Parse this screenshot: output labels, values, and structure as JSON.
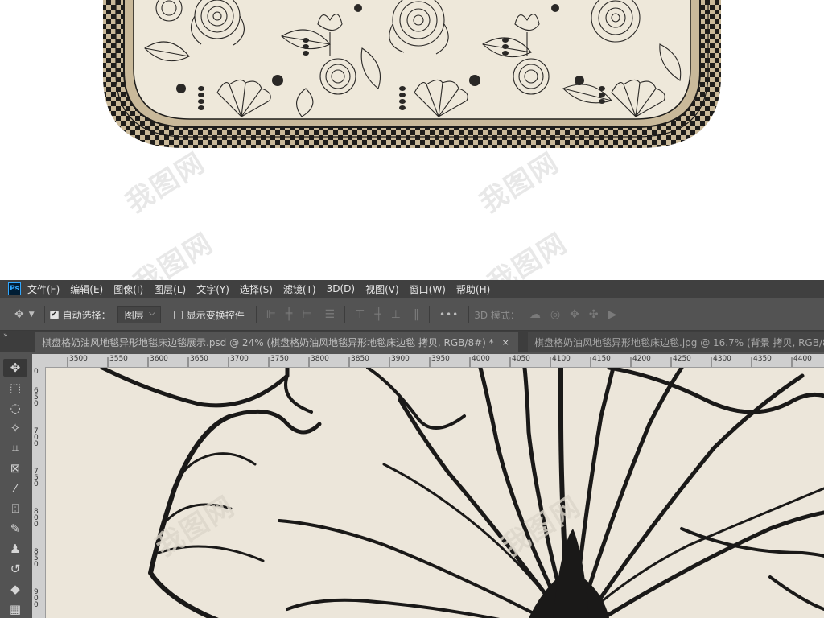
{
  "watermark": {
    "text": "我图网"
  },
  "menubar": {
    "logo": "Ps",
    "items": [
      "文件(F)",
      "编辑(E)",
      "图像(I)",
      "图层(L)",
      "文字(Y)",
      "选择(S)",
      "滤镜(T)",
      "3D(D)",
      "视图(V)",
      "窗口(W)",
      "帮助(H)"
    ]
  },
  "options": {
    "auto_select_label": "自动选择：",
    "auto_select_checked": true,
    "layer_dropdown_value": "图层",
    "show_transform_label": "显示变换控件",
    "show_transform_checked": false,
    "more_label": "•••",
    "mode_3d_label": "3D 模式："
  },
  "tabs": [
    {
      "label": "棋盘格奶油风地毯异形地毯床边毯展示.psd @ 24% (棋盘格奶油风地毯异形地毯床边毯 拷贝, RGB/8#) *",
      "close": "×"
    },
    {
      "label": "棋盘格奶油风地毯异形地毯床边毯.jpg @ 16.7% (背景 拷贝, RGB/8)"
    }
  ],
  "ruler": {
    "h_labels": [
      "3500",
      "3550",
      "3600",
      "3650",
      "3700",
      "3750",
      "3800",
      "3850",
      "3900",
      "3950",
      "4000",
      "4050",
      "4100",
      "4150",
      "4200",
      "4250",
      "4300",
      "4350",
      "4400"
    ],
    "v_labels": [
      "0",
      "6 5 0",
      "7 0 0",
      "7 5 0",
      "8 0 0",
      "8 5 0",
      "9 0 0"
    ]
  },
  "colors": {
    "ps_bg": "#535353",
    "menubar_bg": "#404040",
    "canvas_bg": "#ece6da",
    "rug_beige": "#c9b99a",
    "rug_dark": "#1e1d1b",
    "rug_cream": "#eee8da"
  },
  "icons": [
    "move-icon",
    "marquee-icon",
    "lasso-icon",
    "magic-wand-icon",
    "crop-icon",
    "frame-icon",
    "eyedropper-icon",
    "healing-icon",
    "brush-icon",
    "stamp-icon",
    "history-brush-icon",
    "eraser-icon",
    "gradient-icon"
  ]
}
